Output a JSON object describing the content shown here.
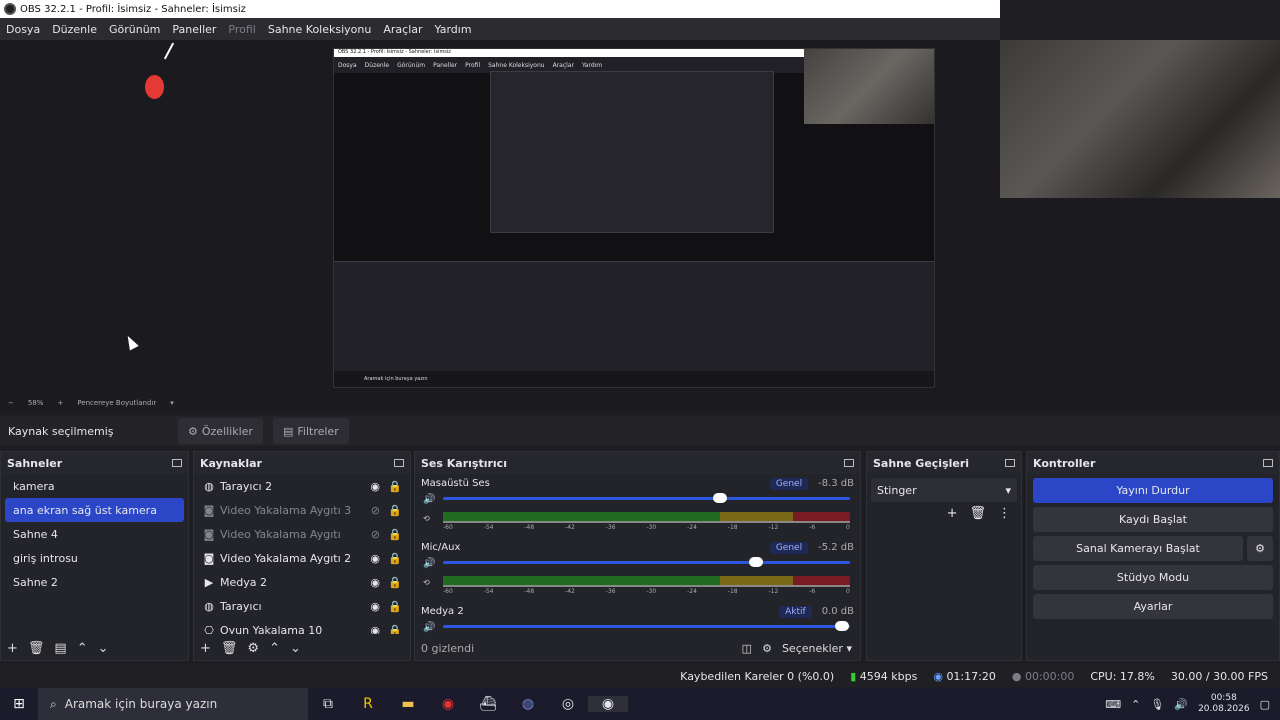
{
  "window": {
    "title": "OBS 32.2.1 - Profil: İsimsiz - Sahneler: İsimsiz"
  },
  "menu": [
    "Dosya",
    "Düzenle",
    "Görünüm",
    "Paneller",
    "Profil",
    "Sahne Koleksiyonu",
    "Araçlar",
    "Yardım"
  ],
  "menu_disabled": "Profil",
  "preview": {
    "zoom": "58%",
    "scale_mode": "Pencereye Boyutlandır"
  },
  "props_bar": {
    "label": "Kaynak seçilmemiş",
    "properties_button": "Özellikler",
    "filters_button": "Filtreler"
  },
  "scenes": {
    "title": "Sahneler",
    "items": [
      "kamera",
      "ana ekran sağ üst  kamera",
      "Sahne 4",
      "giriş introsu",
      "Sahne 2"
    ],
    "active_index": 1
  },
  "sources": {
    "title": "Kaynaklar",
    "items": [
      {
        "label": "Tarayıcı 2",
        "icon": "globe-icon",
        "dim": false
      },
      {
        "label": "Video Yakalama Aygıtı 3",
        "icon": "camera-icon",
        "dim": true
      },
      {
        "label": "Video Yakalama Aygıtı",
        "icon": "camera-icon",
        "dim": true
      },
      {
        "label": "Video Yakalama Aygıtı 2",
        "icon": "camera-icon",
        "dim": false
      },
      {
        "label": "Medya 2",
        "icon": "play-icon",
        "dim": false
      },
      {
        "label": "Tarayıcı",
        "icon": "globe-icon",
        "dim": false
      },
      {
        "label": "Oyun Yakalama 10",
        "icon": "gamepad-icon",
        "dim": false
      }
    ]
  },
  "mixer": {
    "title": "Ses Karıştırıcı",
    "ticks": [
      "-60",
      "-54",
      "-48",
      "-42",
      "-36",
      "-30",
      "-24",
      "-18",
      "-12",
      "-6",
      "0"
    ],
    "channels": [
      {
        "name": "Masaüstü Ses",
        "badge": "Genel",
        "db": "-8.3 dB",
        "level": 0.68
      },
      {
        "name": "Mic/Aux",
        "badge": "Genel",
        "db": "-5.2 dB",
        "level": 0.77
      },
      {
        "name": "Medya 2",
        "badge": "Aktif",
        "db": "0.0 dB",
        "level": 0.98
      }
    ],
    "hidden_label": "0 gizlendi",
    "options_label": "Seçenekler"
  },
  "transitions": {
    "title": "Sahne Geçişleri",
    "selected": "Stinger"
  },
  "controls": {
    "title": "Kontroller",
    "buttons": [
      "Yayını Durdur",
      "Kaydı Başlat",
      "Sanal Kamerayı Başlat",
      "Stüdyo Modu",
      "Ayarlar"
    ]
  },
  "status": {
    "dropped": "Kaybedilen Kareler 0 (%0.0)",
    "bitrate": "4594 kbps",
    "stream_time": "01:17:20",
    "rec_time": "00:00:00",
    "cpu": "CPU: 17.8%",
    "fps": "30.00 / 30.00 FPS"
  },
  "taskbar": {
    "search_placeholder": "Aramak için buraya yazın",
    "time": "00:58",
    "date": "20.08.2026"
  },
  "colors": {
    "accent": "#2b47c7",
    "panel": "#23232a",
    "red": "#e53935"
  }
}
